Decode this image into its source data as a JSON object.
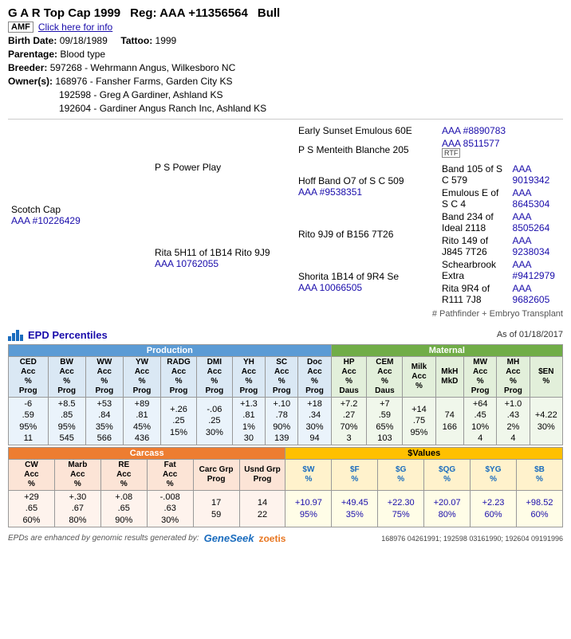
{
  "header": {
    "title": "G A R Top Cap 1999",
    "reg": "Reg: AAA +11356564",
    "type": "Bull",
    "amf_label": "AMF",
    "info_link": "Click here for info",
    "birth_date_label": "Birth Date:",
    "birth_date": "09/18/1989",
    "tattoo_label": "Tattoo:",
    "tattoo": "1999",
    "parentage_label": "Parentage:",
    "parentage": "Blood type",
    "breeder_label": "Breeder:",
    "breeder": "597268 -  Wehrmann Angus, Wilkesboro NC",
    "owner_label": "Owner(s):",
    "owners": [
      "168976 - Fansher Farms, Garden City KS",
      "192598 - Greg A Gardiner, Ashland KS",
      "192604 - Gardiner Angus Ranch Inc, Ashland KS"
    ]
  },
  "pedigree": {
    "sire_line": {
      "level1": {
        "name": "P S Power Play",
        "parents": {
          "sire": {
            "name": "Early Sunset Emulous 60E",
            "reg": "AAA #8890783"
          },
          "dam": {
            "name": "P S Menteith Blanche 205",
            "reg": "AAA 8511577",
            "rtf": true
          }
        }
      },
      "level0": {
        "name": "Scotch Cap",
        "reg": "AAA #10226429",
        "mate": {
          "name": "Hoff Band O7 of S C 509",
          "reg": "AAA #9538351",
          "parents": {
            "sire": {
              "name": "Band 105 of S C 579",
              "reg": "AAA 9019342"
            },
            "dam": {
              "name": "Emulous E of S C 4",
              "reg": "AAA 8645304"
            }
          }
        }
      }
    },
    "dam_line": {
      "level1": {
        "name": "Rito 9J9 of B156 7T26",
        "parents": {
          "sire": {
            "name": "Band 234 of Ideal 2118",
            "reg": "AAA 8505264"
          },
          "dam": {
            "name": "Rito 149 of J845 7T26",
            "reg": "AAA 9238034"
          }
        }
      },
      "level0": {
        "name": "Rita 5H11 of 1B14 Rito 9J9",
        "reg": "AAA 10762055",
        "mate": {
          "name": "Shorita 1B14 of 9R4 Se",
          "reg": "AAA 10066505",
          "parents": {
            "sire": {
              "name": "Schearbrook Extra",
              "reg": "AAA #9412979"
            },
            "dam": {
              "name": "Rita 9R4 of R111 7J8",
              "reg": "AAA 9682605"
            }
          }
        }
      }
    },
    "footnote": "# Pathfinder + Embryo Transplant"
  },
  "epd": {
    "title": "EPD Percentiles",
    "as_of": "As of 01/18/2017",
    "sections": {
      "production": "Production",
      "maternal": "Maternal",
      "carcass": "Carcass",
      "values": "$Values"
    },
    "prod_cols": [
      {
        "label": "CED\nAcc\n%\nProg"
      },
      {
        "label": "BW\nAcc\n%\nProg"
      },
      {
        "label": "WW\nAcc\n%\nProg"
      },
      {
        "label": "YW\nAcc\n%\nProg"
      },
      {
        "label": "RADG\nAcc\n%\nProg"
      },
      {
        "label": "DMI\nAcc\n%\nProg"
      },
      {
        "label": "YH\nAcc\n%\nProg"
      },
      {
        "label": "SC\nAcc\n%\nProg"
      },
      {
        "label": "Doc\nAcc\n%\nProg"
      }
    ],
    "mat_cols": [
      {
        "label": "HP\nAcc\n%\nDaus"
      },
      {
        "label": "CEM\nAcc\n%\nDaus"
      },
      {
        "label": "Milk\nAcc\n%"
      },
      {
        "label": "MkH\nMkD"
      },
      {
        "label": "MW\nAcc\n%\nProg"
      },
      {
        "label": "MH\nAcc\n%\nProg"
      },
      {
        "label": "$EN\n%"
      }
    ],
    "carc_cols": [
      {
        "label": "CW\nAcc\n%"
      },
      {
        "label": "Marb\nAcc\n%"
      },
      {
        "label": "RE\nAcc\n%"
      },
      {
        "label": "Fat\nAcc\n%"
      },
      {
        "label": "Carc Grp\nProg"
      },
      {
        "label": "Usnd Grp\nProg"
      }
    ],
    "val_cols": [
      {
        "label": "$W\n%",
        "color": "blue"
      },
      {
        "label": "$F\n%",
        "color": "blue"
      },
      {
        "label": "$G\n%",
        "color": "blue"
      },
      {
        "label": "$QG\n%",
        "color": "blue"
      },
      {
        "label": "$YG\n%",
        "color": "blue"
      },
      {
        "label": "$B\n%",
        "color": "blue"
      }
    ],
    "prod_values": [
      "-6\n.59\n95%\n11",
      "+8.5\n.85\n95%\n545",
      "+53\n.84\n35%\n566",
      "+89\n.81\n45%\n436",
      "+.26\n.25\n15%",
      "-.06\n.25\n30%",
      "+1.3\n.81\n1%\n30",
      "+.10\n.78\n90%\n139",
      "+18\n.34\n30%\n94"
    ],
    "mat_values": [
      "+7.2\n.27\n70%\n3",
      "+7\n.59\n65%\n103",
      "+14\n.75\n95%",
      "74\n166",
      "+64\n.45\n10%\n4",
      "+1.0\n.43\n2%\n4",
      "+4.22\n30%"
    ],
    "carc_values": [
      "+29\n.65\n60%",
      "+.30\n.67\n80%",
      "+.08\n.65\n90%",
      "-.008\n.63\n30%",
      "17\n59",
      "14\n22"
    ],
    "val_values": [
      "+10.97\n95%",
      "+49.45\n35%",
      "+22.30\n75%",
      "+20.07\n80%",
      "+2.23\n60%",
      "+98.52\n60%"
    ],
    "footer_label": "EPDs are enhanced by genomic results generated by:",
    "footer_ids": "168976 04261991; 192598 03161990; 192604 09191996"
  }
}
